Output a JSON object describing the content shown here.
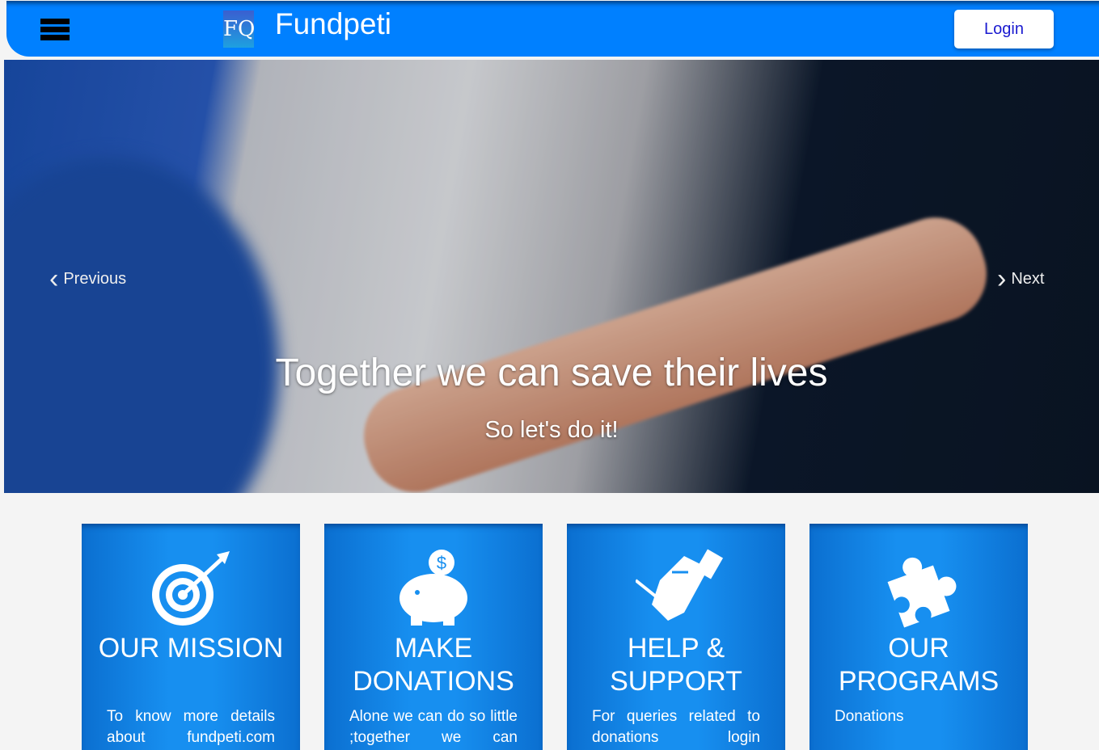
{
  "header": {
    "brand": "Fundpeti",
    "logo_text": "FQ",
    "login_label": "Login"
  },
  "carousel": {
    "prev_label": "Previous",
    "next_label": "Next",
    "title": "Together we can save their lives",
    "subtitle": "So let's do it!"
  },
  "cards": [
    {
      "title": "OUR MISSION",
      "text": "To know more details about fundpeti.com",
      "icon": "target-icon"
    },
    {
      "title": "MAKE DONATIONS",
      "text": "Alone we can do so little ;together we can",
      "icon": "piggy-bank-icon"
    },
    {
      "title": "HELP & SUPPORT",
      "text": "For queries related to donations login",
      "icon": "handshake-icon"
    },
    {
      "title": "OUR PROGRAMS",
      "text": "Donations",
      "icon": "puzzle-icon"
    }
  ]
}
